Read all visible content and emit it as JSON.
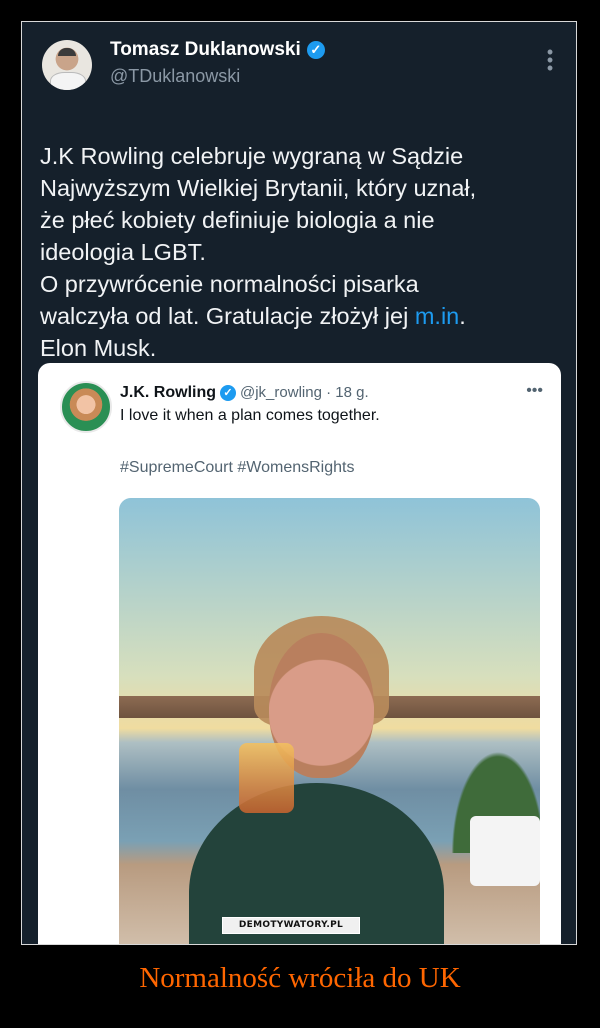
{
  "tweet": {
    "author_name": "Tomasz Duklanowski",
    "author_handle": "@TDuklanowski",
    "text_before_link": "J.K Rowling celebruje wygraną w Sądzie\nNajwyższym Wielkiej Brytanii, który uznał,\nże płeć kobiety definiuje biologia a nie\nideologia LGBT.\nO przywrócenie normalności pisarka\nwalczyła od lat. Gratulacje złożył jej ",
    "link_text": "m.in",
    "text_after_link": ".\nElon Musk."
  },
  "quoted": {
    "author_name": "J.K. Rowling",
    "author_handle": "@jk_rowling · 18 g.",
    "text": "I love it when a plan comes together.",
    "hashtags": "#SupremeCourt #WomensRights"
  },
  "icons": {
    "verified": "verified-badge-icon",
    "more": "more-options-icon"
  },
  "colors": {
    "tweet_background": "#15202b",
    "link": "#1d9bf0",
    "caption": "#ff6600"
  },
  "watermark": "DEMOTYWATORY.PL",
  "caption": "Normalność wróciła do UK"
}
